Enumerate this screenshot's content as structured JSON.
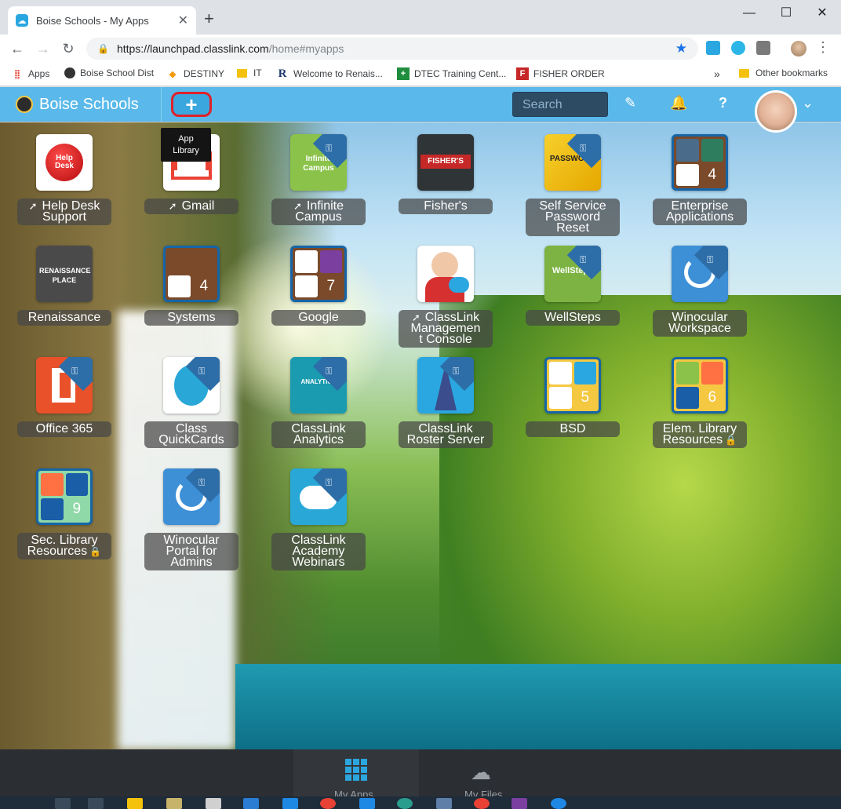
{
  "tab": {
    "title": "Boise Schools - My Apps",
    "close": "✕",
    "new_tab": "+"
  },
  "window": {
    "minimize": "—",
    "maximize": "☐",
    "close": "✕"
  },
  "address": {
    "host": "https://launchpad.classlink.com",
    "path": "/home#myapps"
  },
  "bookmarks": [
    {
      "label": "Apps"
    },
    {
      "label": "Boise School Dist"
    },
    {
      "label": "DESTINY"
    },
    {
      "label": "IT"
    },
    {
      "label": "Welcome to Renais..."
    },
    {
      "label": "DTEC Training Cent..."
    },
    {
      "label": "FISHER ORDER"
    },
    {
      "label": "Other bookmarks"
    }
  ],
  "bookmarks_more": "»",
  "header": {
    "brand": "Boise Schools",
    "add_button": "+",
    "search_placeholder": "Search"
  },
  "tooltip": {
    "line1": "App",
    "line2": "Library"
  },
  "apps": [
    {
      "label_lines": [
        "Help Desk",
        "Support"
      ],
      "launch": true
    },
    {
      "label_lines": [
        "Gmail"
      ],
      "launch": true
    },
    {
      "label_lines": [
        "Infinite",
        "Campus"
      ],
      "launch": true
    },
    {
      "label_lines": [
        "Fisher's"
      ],
      "launch": false
    },
    {
      "label_lines": [
        "Self Service",
        "Password",
        "Reset"
      ],
      "launch": false
    },
    {
      "label_lines": [
        "Enterprise",
        "Applications"
      ],
      "launch": false,
      "folder_count": "4"
    },
    {
      "label_lines": [
        "Renaissance"
      ],
      "launch": false
    },
    {
      "label_lines": [
        "Systems"
      ],
      "launch": false,
      "folder_count": "4"
    },
    {
      "label_lines": [
        "Google"
      ],
      "launch": false,
      "folder_count": "7"
    },
    {
      "label_lines": [
        "ClassLink",
        "Managemen",
        "t Console"
      ],
      "launch": true
    },
    {
      "label_lines": [
        "WellSteps"
      ],
      "launch": false
    },
    {
      "label_lines": [
        "Winocular",
        "Workspace"
      ],
      "launch": false
    },
    {
      "label_lines": [
        "Office 365"
      ],
      "launch": false
    },
    {
      "label_lines": [
        "Class",
        "QuickCards"
      ],
      "launch": false
    },
    {
      "label_lines": [
        "ClassLink",
        "Analytics"
      ],
      "launch": false
    },
    {
      "label_lines": [
        "ClassLink",
        "Roster Server"
      ],
      "launch": false
    },
    {
      "label_lines": [
        "BSD"
      ],
      "launch": false,
      "folder_count": "5"
    },
    {
      "label_lines": [
        "Elem. Library",
        "Resources"
      ],
      "launch": false,
      "folder_count": "6",
      "locked": true
    },
    {
      "label_lines": [
        "Sec. Library",
        "Resources"
      ],
      "launch": false,
      "folder_count": "9",
      "locked": true
    },
    {
      "label_lines": [
        "Winocular",
        "Portal for",
        "Admins"
      ],
      "launch": false
    },
    {
      "label_lines": [
        "ClassLink",
        "Academy",
        "Webinars"
      ],
      "launch": false
    }
  ],
  "icon_text": {
    "help_desk": "Help Desk",
    "infinite_campus": "Infinite Campus",
    "fishers": "FISHER'S",
    "password": "PASSWORD",
    "renaissance": "RENAISSANCE PLACE",
    "wellsteps": "WellSteps",
    "analytics": "ANALYTICS"
  },
  "bottom": {
    "my_apps": "My Apps",
    "my_files": "My Files"
  },
  "colors": {
    "header": "#5ab9ea",
    "accent": "#2ba6df",
    "highlight_ring": "#e0202a"
  }
}
